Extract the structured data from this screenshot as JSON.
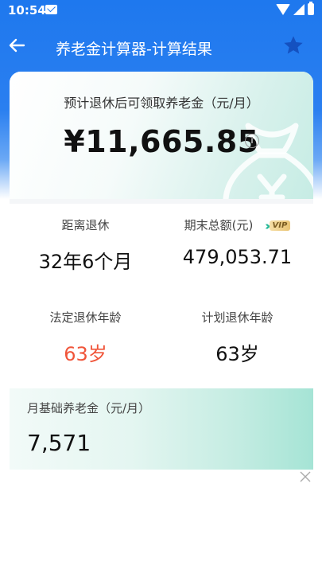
{
  "status_bar": {
    "time": "10:54"
  },
  "app_bar": {
    "title": "养老金计算器-计算结果"
  },
  "summary": {
    "caption": "预计退休后可领取养老金（元/月）",
    "amount": "¥11,665.85",
    "info_icon_text": "i"
  },
  "stats": [
    {
      "label": "距离退休",
      "value": "32年6个月"
    },
    {
      "label": "期末总额(元)",
      "value": "479,053.71",
      "badge": "VIP"
    },
    {
      "label": "法定退休年龄",
      "value": "63岁"
    },
    {
      "label": "计划退休年龄",
      "value": "63岁"
    }
  ],
  "basic_pension": {
    "label": "月基础养老金（元/月）",
    "value": "7,571"
  },
  "colors": {
    "primary": "#1e78ee",
    "accent_red": "#f0553a",
    "teal": "#27b99a"
  }
}
